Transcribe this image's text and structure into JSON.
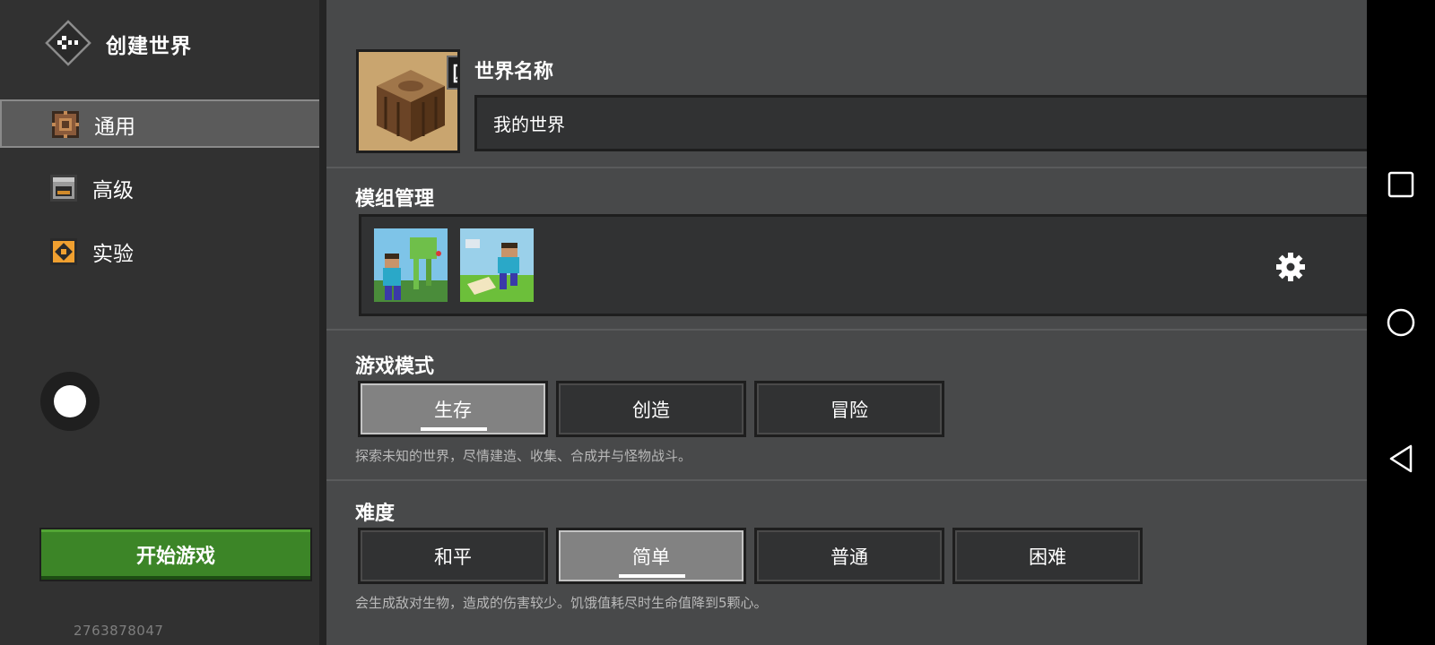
{
  "app": {
    "title": "创建世界",
    "build_id": "2763878047"
  },
  "sidebar": {
    "items": [
      {
        "label": "通用",
        "icon": "gear-block-icon",
        "active": true
      },
      {
        "label": "高级",
        "icon": "furnace-icon",
        "active": false
      },
      {
        "label": "实验",
        "icon": "redstone-block-icon",
        "active": false
      }
    ],
    "start_label": "开始游戏"
  },
  "world": {
    "name_label": "世界名称",
    "name_value": "我的世界"
  },
  "addons": {
    "label": "模组管理",
    "packs": [
      "resource-pack-thumbnail",
      "behavior-pack-thumbnail"
    ]
  },
  "game_mode": {
    "label": "游戏模式",
    "options": [
      "生存",
      "创造",
      "冒险"
    ],
    "selected": "生存",
    "hint": "探索未知的世界，尽情建造、收集、合成并与怪物战斗。"
  },
  "difficulty": {
    "label": "难度",
    "options": [
      "和平",
      "简单",
      "普通",
      "困难"
    ],
    "selected": "简单",
    "hint": "会生成敌对生物，造成的伤害较少。饥饿值耗尽时生命值降到5颗心。"
  },
  "colors": {
    "sidebar_bg": "#313131",
    "main_bg": "#48494a",
    "start_green": "#3c8527",
    "selected_btn": "#828282"
  }
}
